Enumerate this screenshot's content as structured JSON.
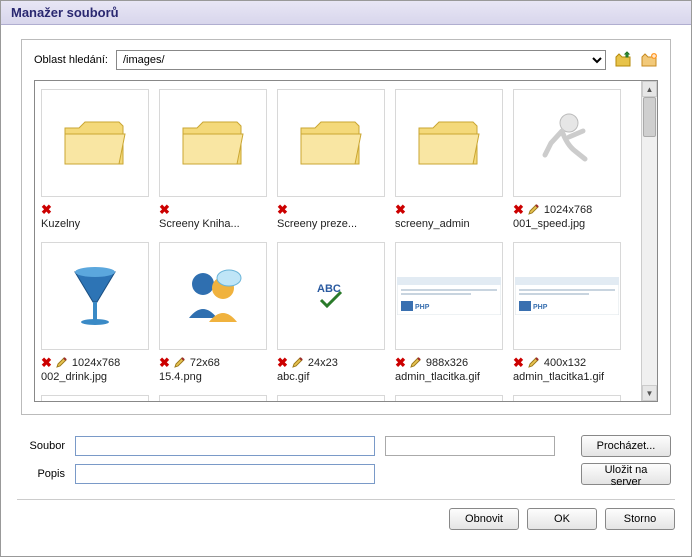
{
  "window": {
    "title": "Manažer souborů"
  },
  "search": {
    "label": "Oblast hledání:",
    "path": "/images/"
  },
  "icons": {
    "folder_up": "folder-up-icon",
    "new_folder": "new-folder-icon"
  },
  "items": [
    {
      "type": "folder",
      "label": "Kuzelny",
      "has_pencil": false,
      "dims": ""
    },
    {
      "type": "folder",
      "label": "Screeny Kniha...",
      "has_pencil": false,
      "dims": ""
    },
    {
      "type": "folder",
      "label": "Screeny preze...",
      "has_pencil": false,
      "dims": ""
    },
    {
      "type": "folder",
      "label": "screeny_admin",
      "has_pencil": false,
      "dims": ""
    },
    {
      "type": "image",
      "thumb": "runner",
      "label": "001_speed.jpg",
      "has_pencil": true,
      "dims": "1024x768"
    },
    {
      "type": "image",
      "thumb": "drink",
      "label": "002_drink.jpg",
      "has_pencil": true,
      "dims": "1024x768"
    },
    {
      "type": "image",
      "thumb": "users",
      "label": "15.4.png",
      "has_pencil": true,
      "dims": "72x68"
    },
    {
      "type": "image",
      "thumb": "abc",
      "label": "abc.gif",
      "has_pencil": true,
      "dims": "24x23"
    },
    {
      "type": "image",
      "thumb": "banner",
      "label": "admin_tlacitka.gif",
      "has_pencil": true,
      "dims": "988x326"
    },
    {
      "type": "image",
      "thumb": "banner",
      "label": "admin_tlacitka1.gif",
      "has_pencil": true,
      "dims": "400x132"
    }
  ],
  "form": {
    "file_label": "Soubor",
    "desc_label": "Popis",
    "file_value": "",
    "desc_value": "",
    "browse_btn": "Procházet...",
    "upload_btn": "Uložit na server"
  },
  "footer": {
    "refresh": "Obnovit",
    "ok": "OK",
    "cancel": "Storno"
  }
}
